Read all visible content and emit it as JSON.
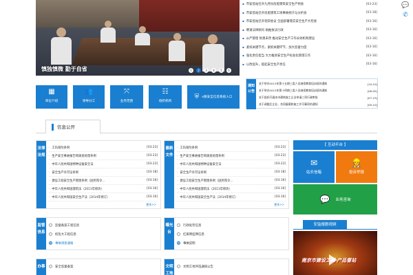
{
  "banner": {
    "caption": "慎独慎微 勤于自省",
    "dots": [
      "1",
      "2",
      "3",
      "4",
      "5",
      "6"
    ],
    "active_dot": 1
  },
  "news": [
    {
      "title": "市安监站召开九月份房屋建筑安全生产例会",
      "date": "[03-23]"
    },
    {
      "title": "市安监站召开房屋建筑工地事故统计与分析会",
      "date": "[03-18]"
    },
    {
      "title": "市安监站召开装卸会议 全面部署落实安全生产大检查",
      "date": "[03-16]"
    },
    {
      "title": "聘请法律顾问 助推依法行政",
      "date": "[03-16]"
    },
    {
      "title": "从严管理 防患未然 推动安全生产工作长效机制建设",
      "date": "[03-16]"
    },
    {
      "title": "紧扣关键节点，紧抓关键环节，加大监督力度",
      "date": "[03-16]"
    },
    {
      "title": "强化责任担当 大力推进安全生产标准化管理工作",
      "date": "[03-16]"
    },
    {
      "title": "以改促升，提起安全生产责任",
      "date": "[03-16]"
    }
  ],
  "quick_buttons": [
    {
      "label": "单位介绍",
      "icon": "building-icon"
    },
    {
      "label": "领导分工",
      "icon": "people-icon"
    },
    {
      "label": "业务范围",
      "icon": "expand-icon"
    },
    {
      "label": "组织机构",
      "icon": "org-chart-icon"
    },
    {
      "label": "e路安全信息系统入口",
      "icon": "shield-icon"
    }
  ],
  "notice": {
    "label": "通知公告",
    "items": [
      {
        "title": "关于举办2015年第十五期三类人员继续教育培训班的通知",
        "date": "[10-10]"
      },
      {
        "title": "关于举办2015年第十四期三类人员继续教育培训班的通知",
        "date": "[08-05]"
      },
      {
        "title": "关于组织开展本市建筑施工企业申请三项行政审批",
        "date": "[07-23]"
      },
      {
        "title": "关于调整后企业、合同备案和施工许可事项的通知",
        "date": "[09-10]"
      }
    ]
  },
  "tab": {
    "label": "信息公开"
  },
  "laws": {
    "label": "法律法规",
    "more": "更多>>",
    "items": [
      {
        "title": "工伤保险条例",
        "date": "[03-23]"
      },
      {
        "title": "生产安全事故报告和调查处理条例",
        "date": "[03-23]"
      },
      {
        "title": "中华人民共和国特种设备安全法",
        "date": "[03-23]"
      },
      {
        "title": "安全生产许可证条例",
        "date": "[03-18]"
      },
      {
        "title": "建设工程安全生产管理条例（国务院令...",
        "date": "[03-16]"
      },
      {
        "title": "中华人民共和国建筑法（2011年修改）",
        "date": "[03-16]"
      },
      {
        "title": "中华人民共和国安全生产法（2014年修订）",
        "date": "[03-16]"
      }
    ]
  },
  "docs": {
    "label": "最新文件",
    "more": "更多>>",
    "items": [
      {
        "title": "工伤保险条例",
        "date": "[03-23]"
      },
      {
        "title": "生产安全事故报告和调查处理条例",
        "date": "[03-23]"
      },
      {
        "title": "中华人民共和国特种设备安全法",
        "date": "[03-23]"
      },
      {
        "title": "安全生产许可证条例",
        "date": "[03-18]"
      },
      {
        "title": "建设工程安全生产管理条例（国务院令...",
        "date": "[03-16]"
      },
      {
        "title": "中华人民共和国建筑法（2011年修改）",
        "date": "[03-16]"
      },
      {
        "title": "中华人民共和国安全生产法（2014年修订）",
        "date": "[03-16]"
      }
    ]
  },
  "supervise": {
    "label": "监管信息",
    "items": [
      "监督备案工程信息",
      "桩危大工程信息",
      "事故调查通报"
    ]
  },
  "exposure": {
    "label": "曝光台",
    "items": [
      "行政处罚信息",
      "红黄牌挂牌信息",
      "事故说明"
    ]
  },
  "office": {
    "label": "办事",
    "items": [
      "安全监督备案"
    ]
  },
  "civilized": {
    "label": "文明工地",
    "items": [
      "文明工地评选通知公告"
    ]
  },
  "platform": {
    "header": "【 互动平台 】",
    "cells": [
      {
        "label": "站长信箱",
        "icon": "mail-icon"
      },
      {
        "label": "投诉举报",
        "icon": "worker-icon"
      },
      {
        "label": "业务咨询",
        "icon": "chat-icon"
      }
    ]
  },
  "video": {
    "title": "安监报剧视频",
    "overlay": "南京市建设工程 产品督站"
  }
}
